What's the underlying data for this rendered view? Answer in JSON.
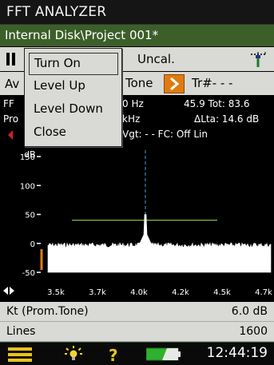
{
  "app_title": "FFT ANALYZER",
  "path": "Internal Disk\\Project 001*",
  "status": {
    "state_icon": "pause-icon",
    "calibration": "Uncal.",
    "tripod_icon": "tripod-icon"
  },
  "measure_row": {
    "left": "Av",
    "mode": "Tone",
    "arrow_icon": "chevron-right-icon",
    "track": "Tr#- - -"
  },
  "header": {
    "line1_left": "FF",
    "line1_freq": "0 Hz",
    "line1_right": "45.9 Tot: 83.6",
    "line2_left": "Pro",
    "line2_freq": "kHz",
    "line2_right": "ΔLta: 14.6 dB",
    "line3_right": "Vgt: - -  FC: Off  Lin"
  },
  "chart_data": {
    "type": "line",
    "ylabel": "dB",
    "y_ticks": [
      "150",
      "100",
      "50",
      "0",
      "-50"
    ],
    "x_ticks": [
      "3.5k",
      "3.7k",
      "4.0k",
      "4.2k",
      "4.5k",
      "4.7k"
    ],
    "cursor_freq_label": "4.0k",
    "ylim": [
      -50,
      150
    ],
    "noise_floor_db": -3,
    "peak_db": 50,
    "reference_line_db": 40,
    "colors": {
      "spectrum": "#ffffff",
      "reference": "#8fbf3a",
      "cursor": "#38a9e0",
      "level_bar": "#e07b10"
    }
  },
  "info_rows": [
    {
      "label": "Kt (Prom.Tone)",
      "value": "6.0 dB"
    },
    {
      "label": "Lines",
      "value": "1600"
    }
  ],
  "bottom_bar": {
    "menu_icon": "hamburger-menu-icon",
    "light_icon": "backlight-icon",
    "help_icon": "help-icon",
    "battery_icon": "battery-icon",
    "time": "12:44:19"
  },
  "popup_menu": {
    "items": [
      {
        "label": "Turn On",
        "selected": true
      },
      {
        "label": "Level Up",
        "selected": false
      },
      {
        "label": "Level Down",
        "selected": false
      },
      {
        "label": "Close",
        "selected": false
      }
    ]
  }
}
